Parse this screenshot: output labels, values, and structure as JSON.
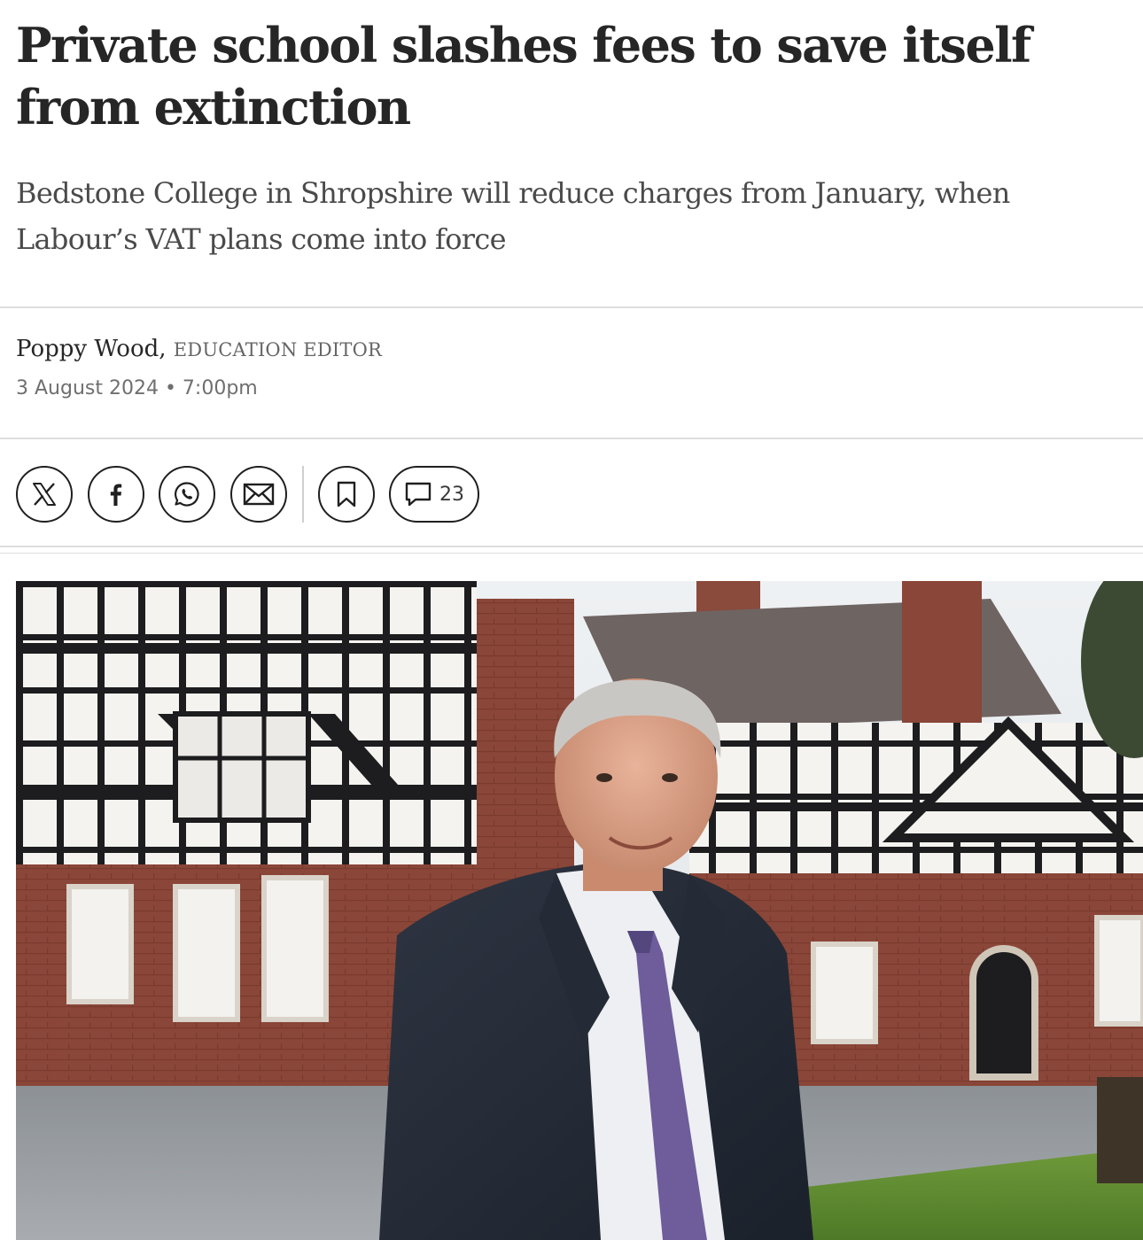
{
  "article": {
    "headline": "Private school slashes fees to save itself from extinction",
    "standfirst": "Bedstone College in Shropshire will reduce charges from January, when Labour’s VAT plans come into force",
    "author": {
      "name": "Poppy Wood,",
      "role": "EDUCATION EDITOR"
    },
    "date": "3 August 2024 • 7:00pm"
  },
  "share": {
    "icons": [
      "x-icon",
      "facebook-icon",
      "whatsapp-icon",
      "email-icon",
      "bookmark-icon",
      "comment-icon"
    ],
    "comment_count": "23"
  },
  "colors": {
    "text": "#262626",
    "standfirst": "#4a4a4a",
    "muted": "#6f6f6f",
    "rule": "#dedede",
    "button_border": "#1f1f1f"
  }
}
